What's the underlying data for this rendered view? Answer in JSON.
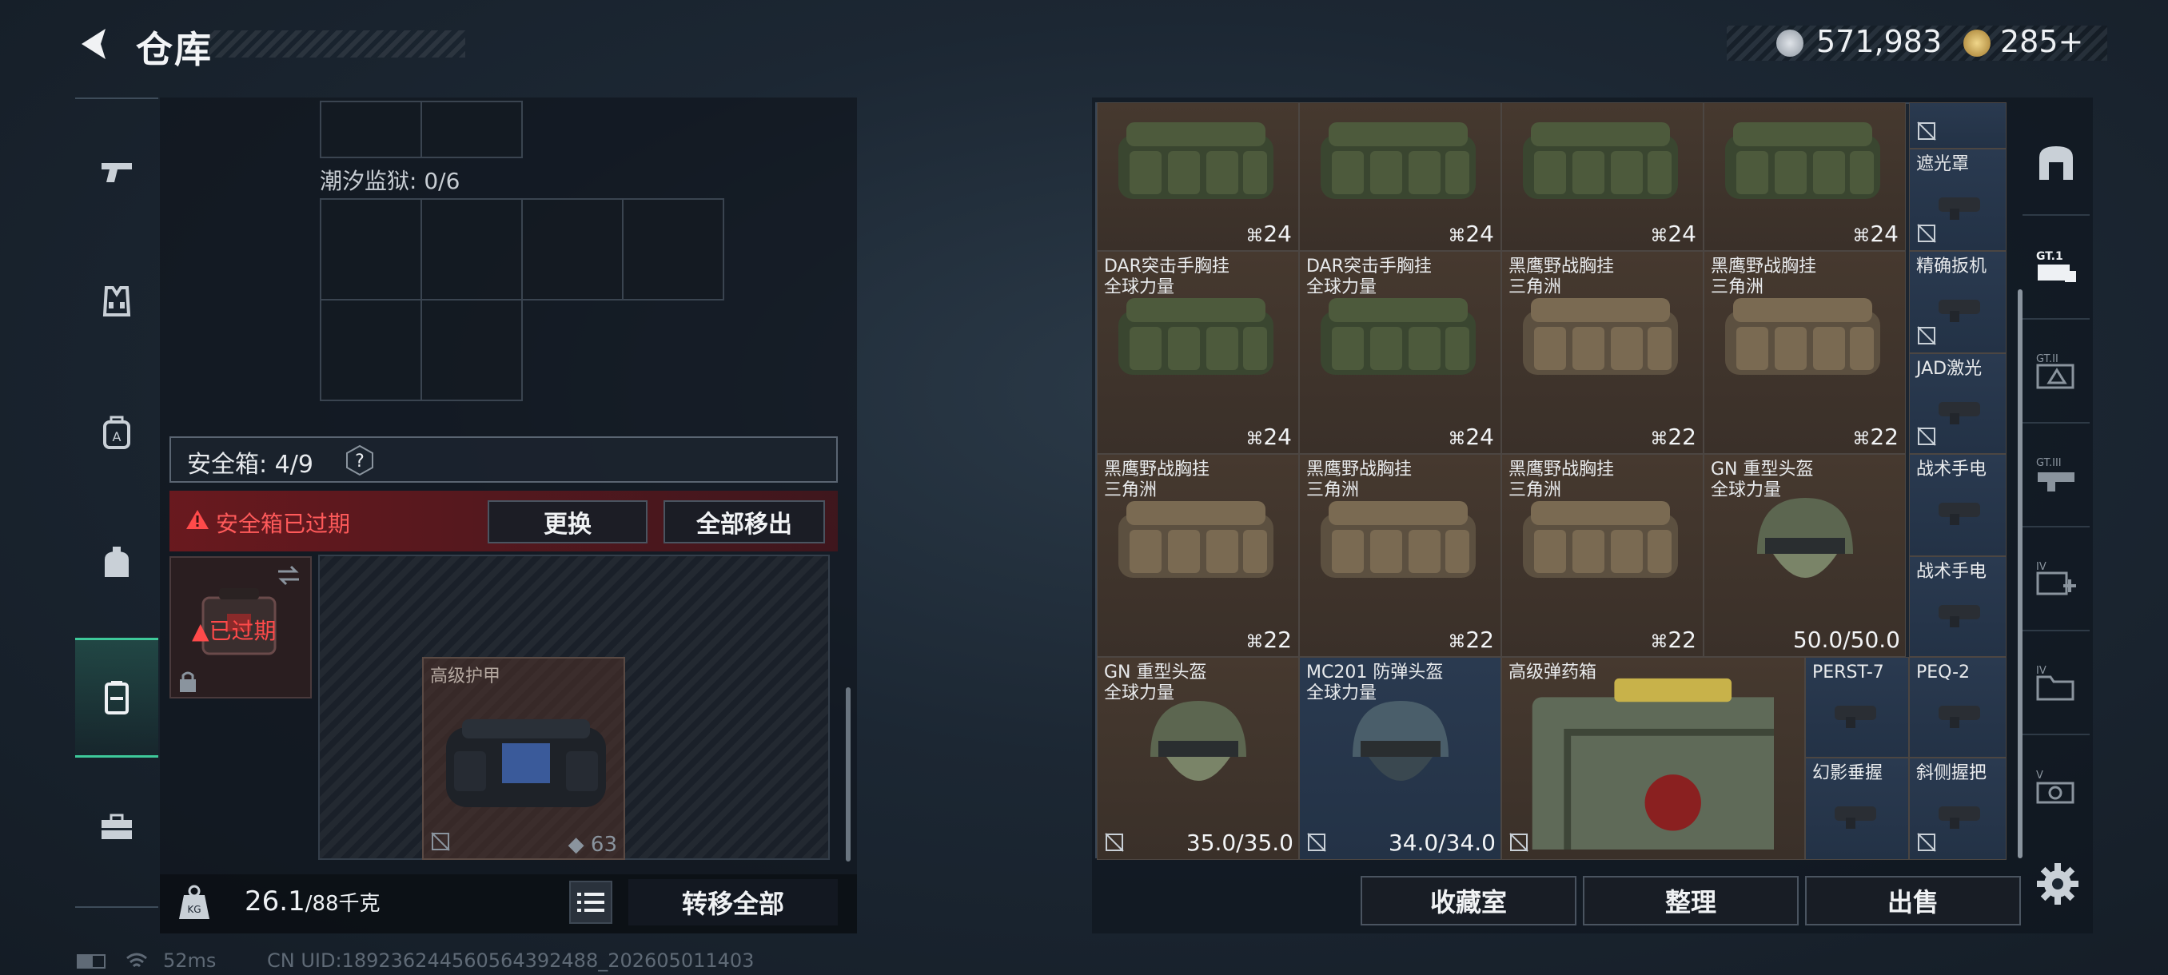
{
  "header": {
    "title": "仓库"
  },
  "currency": {
    "coins": "571,983",
    "tickets": "285",
    "tickets_plus": "+"
  },
  "left": {
    "prison_label": "潮汐监狱: 0/6",
    "safebox_label": "安全箱: 4/9",
    "help": "?",
    "expired_text": "安全箱已过期",
    "replace_label": "更换",
    "remove_all_label": "全部移出",
    "case_status": "已过期",
    "armor_name": "高级护甲",
    "armor_value": "63",
    "weight_value": "26.1",
    "weight_max": "/88千克",
    "transfer_all_label": "转移全部"
  },
  "items": [
    {
      "name": "",
      "count": "24",
      "tone": "brown"
    },
    {
      "name": "",
      "count": "24",
      "tone": "brown"
    },
    {
      "name": "",
      "count": "24",
      "tone": "brown"
    },
    {
      "name": "",
      "count": "24",
      "tone": "brown"
    },
    {
      "name": "DAR突击手胸挂\n全球力量",
      "count": "24",
      "tone": "brown"
    },
    {
      "name": "DAR突击手胸挂\n全球力量",
      "count": "24",
      "tone": "brown"
    },
    {
      "name": "黑鹰野战胸挂\n三角洲",
      "count": "22",
      "tone": "brown"
    },
    {
      "name": "黑鹰野战胸挂\n三角洲",
      "count": "22",
      "tone": "brown"
    },
    {
      "name": "黑鹰野战胸挂\n三角洲",
      "count": "22",
      "tone": "brown"
    },
    {
      "name": "黑鹰野战胸挂\n三角洲",
      "count": "22",
      "tone": "brown"
    },
    {
      "name": "黑鹰野战胸挂\n三角洲",
      "count": "22",
      "tone": "brown"
    },
    {
      "name": "GN 重型头盔\n全球力量",
      "dura": "50.0/50.0",
      "tone": "brown"
    },
    {
      "name": "GN 重型头盔\n全球力量",
      "dura": "35.0/35.0",
      "tone": "brown"
    },
    {
      "name": "MC201 防弹头盔\n全球力量",
      "dura": "34.0/34.0",
      "tone": "blue"
    },
    {
      "name": "高级弹药箱",
      "tone": "brown"
    }
  ],
  "small_items": [
    {
      "name": "遮光罩"
    },
    {
      "name": "精确扳机"
    },
    {
      "name": "JAD激光"
    },
    {
      "name": "战术手电"
    },
    {
      "name": "战术手电"
    },
    {
      "name": "PERST-7"
    },
    {
      "name": "PEQ-2"
    },
    {
      "name": "幻影垂握"
    },
    {
      "name": "斜侧握把"
    }
  ],
  "bottom": {
    "collection_label": "收藏室",
    "sort_label": "整理",
    "sell_label": "出售"
  },
  "status": {
    "ping": "52ms",
    "uid": "CN UID:18923624456056439248​8_202605011403"
  },
  "colors": {
    "accent": "#3ec99a",
    "expired": "#ff5a5a",
    "tile_brown": "#46392f",
    "tile_blue": "#2a3a50"
  }
}
